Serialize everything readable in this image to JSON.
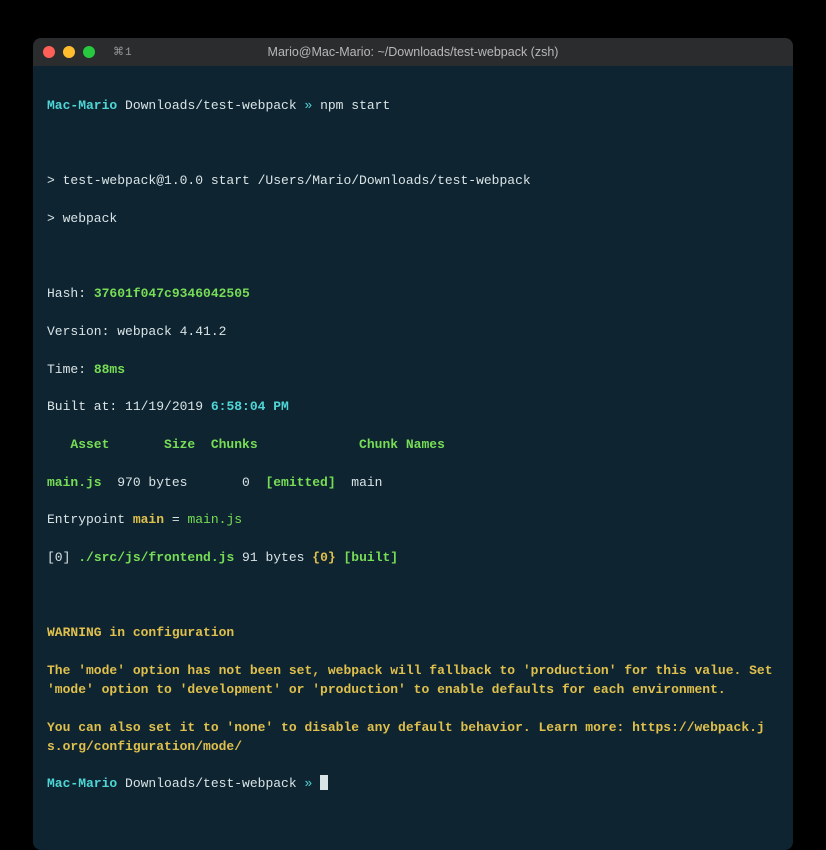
{
  "titlebar": {
    "icon_text": "⌘1",
    "title": "Mario@Mac-Mario: ~/Downloads/test-webpack (zsh)"
  },
  "prompt": {
    "host": "Mac-Mario",
    "path": "Downloads/test-webpack",
    "sep": " » ",
    "command": "npm start"
  },
  "script": {
    "line1": "> test-webpack@1.0.0 start /Users/Mario/Downloads/test-webpack",
    "line2": "> webpack"
  },
  "stats": {
    "hash_label": "Hash: ",
    "hash_value": "37601f047c9346042505",
    "version_label": "Version: ",
    "version_value": "webpack 4.41.2",
    "time_label": "Time: ",
    "time_value": "88ms",
    "built_label": "Built at: ",
    "built_date": "11/19/2019 ",
    "built_time": "6:58:04 PM"
  },
  "table": {
    "header": "   Asset       Size  Chunks             Chunk Names",
    "row_asset": "main.js",
    "row_size": "  970 bytes",
    "row_chunks": "       0  ",
    "row_emitted": "[emitted]",
    "row_chunknames": "  main"
  },
  "entry": {
    "prefix": "Entrypoint ",
    "name": "main",
    "eq": " = ",
    "file": "main.js"
  },
  "module": {
    "idx": "[0] ",
    "path": "./src/js/frontend.js",
    "size": " 91 bytes ",
    "chunks": "{0}",
    "sp": " ",
    "built": "[built]"
  },
  "warning": {
    "heading": "WARNING in configuration",
    "body": "The 'mode' option has not been set, webpack will fallback to 'production' for this value. Set 'mode' option to 'development' or 'production' to enable defaults for each environment.",
    "body2": "You can also set it to 'none' to disable any default behavior. Learn more: https://webpack.js.org/configuration/mode/"
  }
}
